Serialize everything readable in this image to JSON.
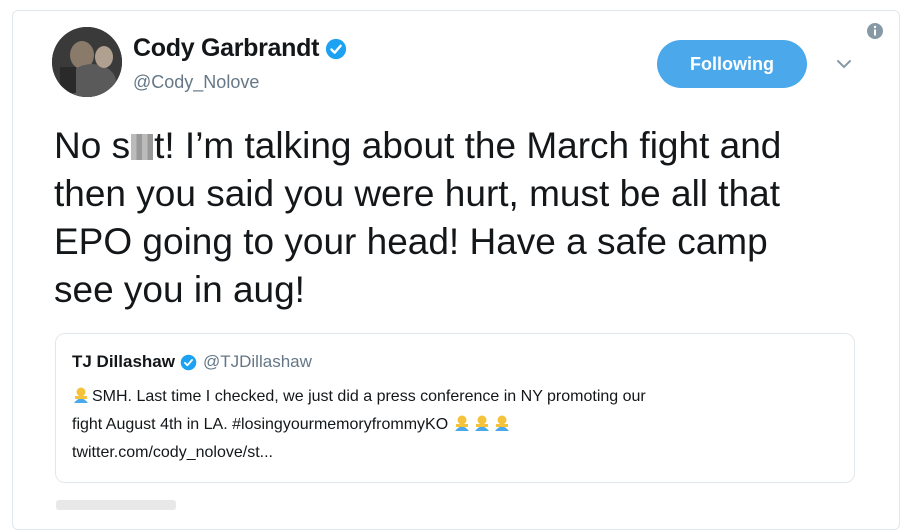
{
  "author": {
    "name": "Cody Garbrandt",
    "handle": "@Cody_Nolove"
  },
  "actions": {
    "follow_label": "Following"
  },
  "tweet": {
    "text_part1": "No s",
    "text_part2": "t! I’m talking about the March fight and\nthen you said you were hurt, must be all that\nEPO going to your head! Have a safe camp\nsee you in aug!"
  },
  "quoted_tweet": {
    "name": "TJ Dillashaw",
    "handle": "@TJDillashaw",
    "line1": "SMH. Last time I checked, we just did a press conference in NY promoting our",
    "line2": "fight August 4th in LA. #losingyourmemoryfrommyKO",
    "line3": "twitter.com/cody_nolove/st..."
  },
  "icons": {
    "verified": "verified-badge-icon",
    "chevron": "chevron-down-icon",
    "info": "info-icon",
    "emoji": "person-emoji-icon"
  },
  "colors": {
    "accent": "#4aa8eb",
    "verified": "#1da1f2",
    "secondary_text": "#657786",
    "border": "#e1e8ed"
  }
}
